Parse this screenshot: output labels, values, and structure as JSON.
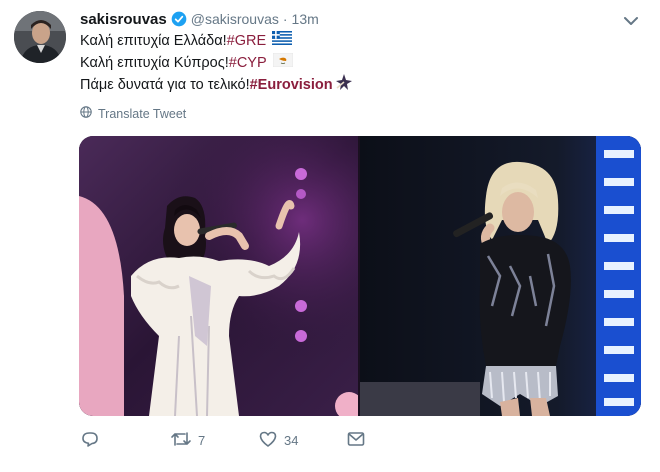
{
  "tweet": {
    "display_name": "sakisrouvas",
    "handle": "@sakisrouvas",
    "separator": "·",
    "time": "13m",
    "lines": [
      {
        "text": "Καλή επιτυχία Ελλάδα! ",
        "hashtag": "#GRE"
      },
      {
        "text": "Καλή επιτυχία Κύπρος! ",
        "hashtag": "#CYP"
      },
      {
        "text": "Πάμε δυνατά για το τελικό! ",
        "hashtag": "#Eurovision"
      }
    ],
    "translate_label": "Translate Tweet",
    "retweet_count": "7",
    "like_count": "34"
  },
  "icons": [
    "verified-badge-icon",
    "chevron-down-icon",
    "globe-icon",
    "greece-flag-icon",
    "cyprus-flag-icon",
    "eurovision-emoji-icon",
    "reply-icon",
    "retweet-icon",
    "like-icon",
    "message-icon"
  ],
  "colors": {
    "hashtag": "#8a1e3d",
    "verified": "#1da1f2",
    "meta": "#657786"
  }
}
